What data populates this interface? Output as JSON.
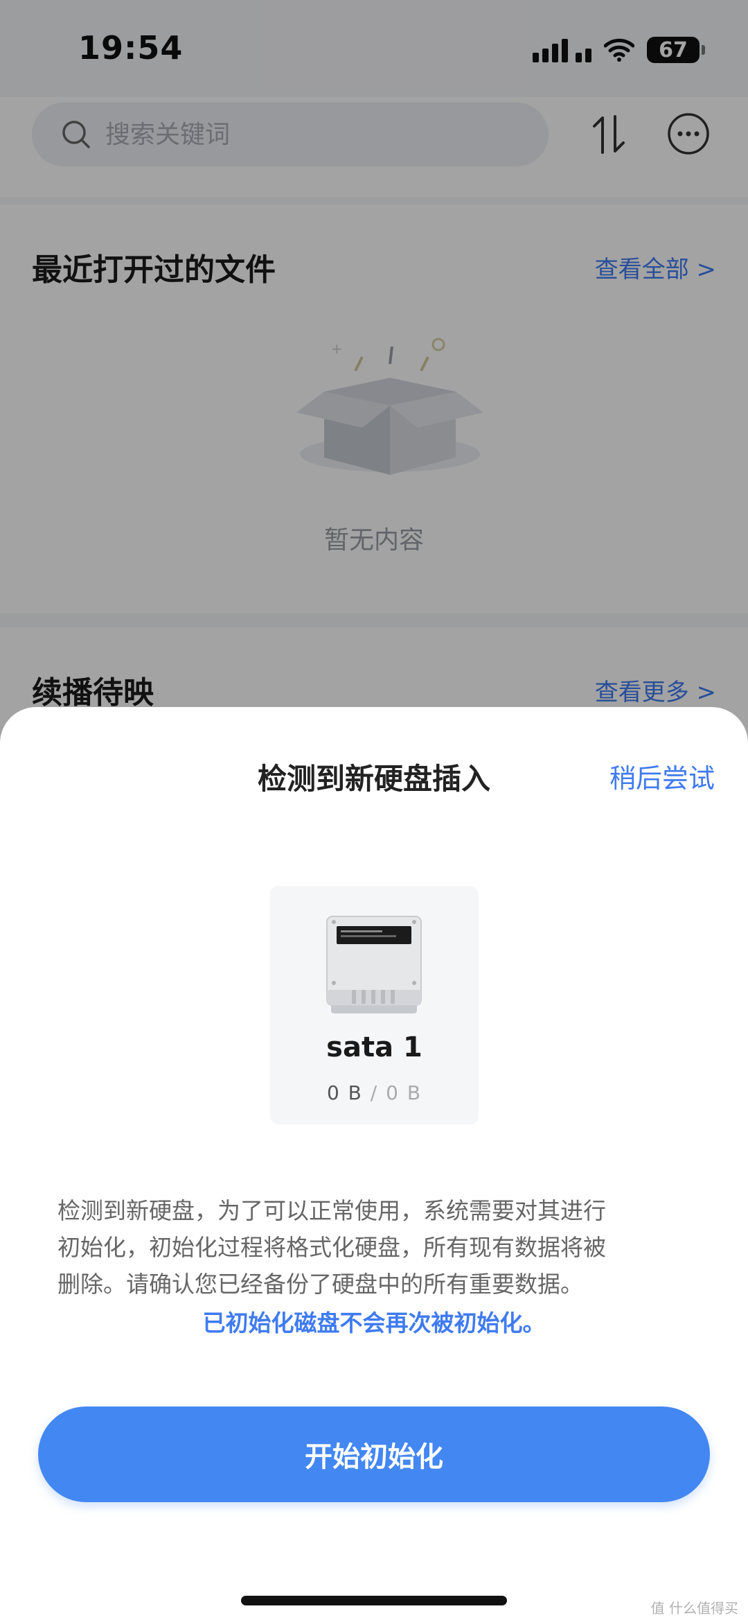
{
  "status_bar": {
    "time": "19:54",
    "battery": "67"
  },
  "search": {
    "placeholder": "搜索关键词"
  },
  "recent": {
    "title": "最近打开过的文件",
    "link": "查看全部 >",
    "empty_text": "暂无内容"
  },
  "continue": {
    "title": "续播待映",
    "link": "查看更多 >"
  },
  "dialog": {
    "title": "检测到新硬盘插入",
    "later_label": "稍后尝试",
    "disk": {
      "name": "sata 1",
      "used": "0 B",
      "separator": "/",
      "total": "0 B"
    },
    "description_lines": [
      "检测到新硬盘，为了可以正常使用，系统需要对其进行",
      "初始化，初始化过程将格式化硬盘，所有现有数据将被",
      "删除。请确认您已经备份了硬盘中的所有重要数据。"
    ],
    "highlight": "已初始化磁盘不会再次被初始化。",
    "init_label": "开始初始化"
  },
  "watermark": "值 什么值得买",
  "colors": {
    "accent": "#3f7bf0",
    "button": "#4387f2"
  }
}
